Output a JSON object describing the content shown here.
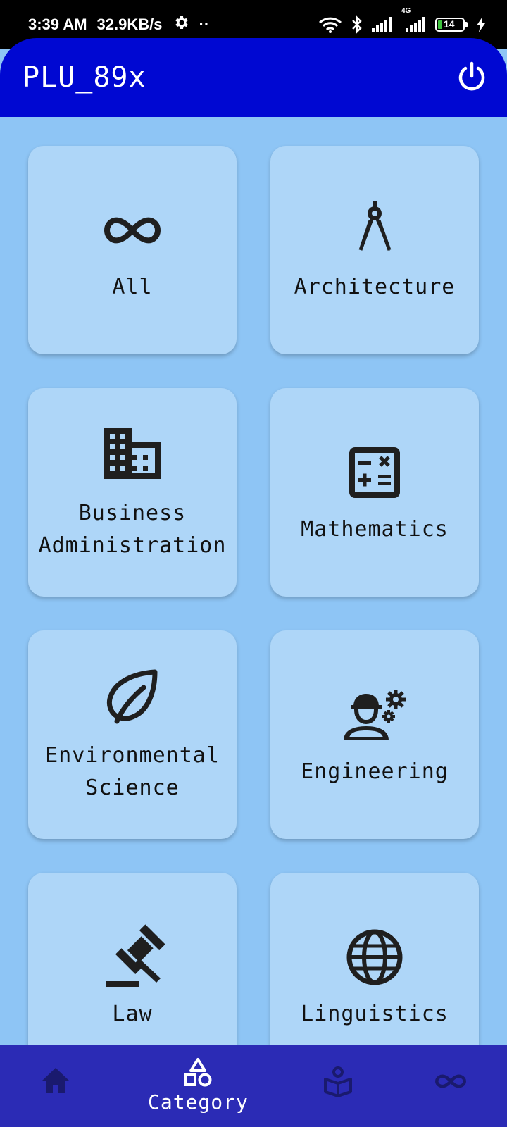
{
  "status_bar": {
    "time": "3:39 AM",
    "speed": "32.9KB/s",
    "dots": "··",
    "network": "4G",
    "battery": "14"
  },
  "app_bar": {
    "title": "PLU_89x"
  },
  "categories": [
    {
      "label": "All",
      "icon": "infinity-icon"
    },
    {
      "label": "Architecture",
      "icon": "compass-icon"
    },
    {
      "label": "Business Administration",
      "icon": "building-icon"
    },
    {
      "label": "Mathematics",
      "icon": "calculator-icon"
    },
    {
      "label": "Environmental Science",
      "icon": "leaf-icon"
    },
    {
      "label": "Engineering",
      "icon": "engineer-icon"
    },
    {
      "label": "Law",
      "icon": "gavel-icon"
    },
    {
      "label": "Linguistics",
      "icon": "globe-icon"
    }
  ],
  "bottom_nav": {
    "items": [
      {
        "name": "home",
        "icon": "home-icon",
        "label": ""
      },
      {
        "name": "category",
        "icon": "shapes-icon",
        "label": "Category",
        "active": true
      },
      {
        "name": "learn",
        "icon": "reader-icon",
        "label": ""
      },
      {
        "name": "all",
        "icon": "infinity-icon",
        "label": ""
      }
    ]
  },
  "colors": {
    "status_bar": "#000000",
    "app_bar": "#0008d2",
    "background": "#8ec5f5",
    "card": "#aed6f8",
    "bottom_nav": "#2b2bb5",
    "inactive_nav_icon": "#1a1a6e"
  }
}
